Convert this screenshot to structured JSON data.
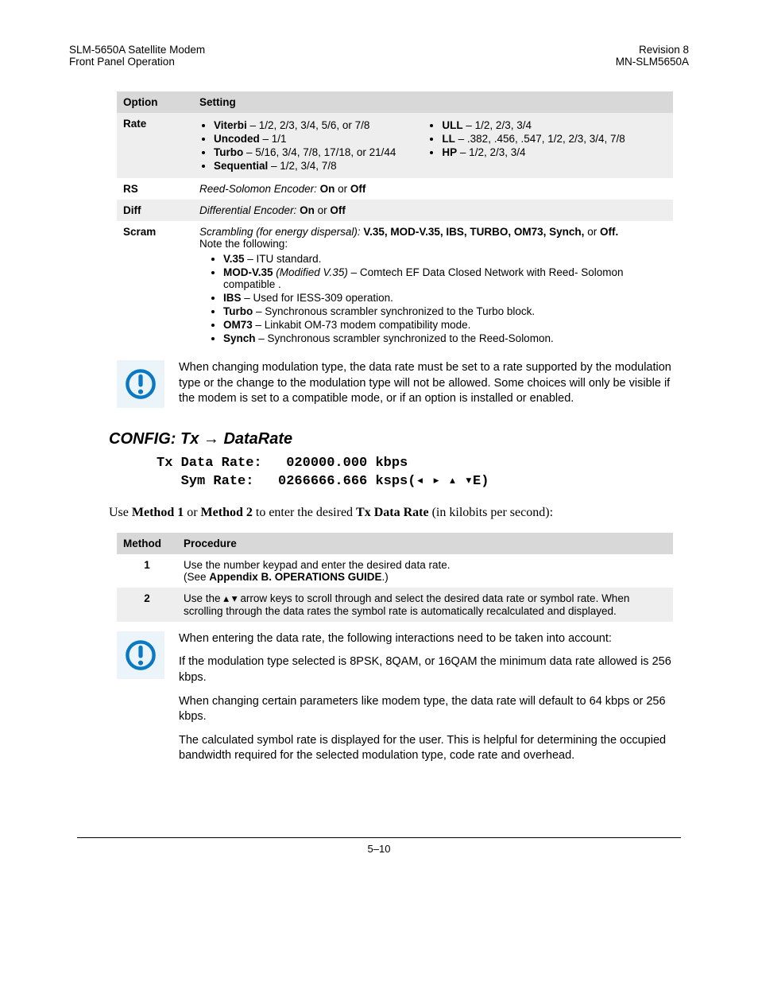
{
  "header": {
    "left": "SLM-5650A Satellite Modem\nFront Panel Operation",
    "right": "Revision 8\nMN-SLM5650A"
  },
  "table1": {
    "head_option": "Option",
    "head_setting": "Setting",
    "rate_label": "Rate",
    "rate_col1": {
      "viterbi_b": "Viterbi",
      "viterbi_t": " – 1/2, 2/3, 3/4, 5/6, or 7/8",
      "uncoded_b": "Uncoded",
      "uncoded_t": " – 1/1",
      "turbo_b": "Turbo",
      "turbo_t": " – 5/16, 3/4, 7/8, 17/18, or 21/44",
      "seq_b": "Sequential",
      "seq_t": " – 1/2, 3/4, 7/8"
    },
    "rate_col2": {
      "ull_b": "ULL",
      "ull_t": " – 1/2, 2/3, 3/4",
      "ll_b": "LL",
      "ll_t": " – .382, .456, .547, 1/2, 2/3, 3/4, 7/8",
      "hp_b": "HP",
      "hp_t": " – 1/2, 2/3, 3/4"
    },
    "rs_label": "RS",
    "rs_i": "Reed-Solomon Encoder: ",
    "rs_b1": "On",
    "rs_mid": " or ",
    "rs_b2": "Off",
    "diff_label": "Diff",
    "diff_i": "Differential Encoder: ",
    "diff_b1": "On",
    "diff_mid": " or ",
    "diff_b2": "Off",
    "scram_label": "Scram",
    "scram_i": "Scrambling (for energy dispersal): ",
    "scram_opts": "V.35, MOD-V.35, IBS, TURBO, OM73, Synch, ",
    "scram_or": "or ",
    "scram_off": "Off.",
    "scram_note": "Note the following:",
    "scram_items": {
      "v35_b": "V.35",
      "v35_t": " – ITU standard.",
      "mod_b": "MOD-V.35",
      "mod_i": " (Modified V.35)",
      "mod_t": " – Comtech EF Data Closed Network with Reed- Solomon compatible .",
      "ibs_b": "IBS",
      "ibs_t": " – Used for IESS-309 operation.",
      "turbo_b": "Turbo",
      "turbo_t": " – Synchronous scrambler synchronized to the Turbo block.",
      "om73_b": "OM73",
      "om73_t": " – Linkabit OM-73 modem compatibility mode.",
      "synch_b": "Synch",
      "synch_t": " – Synchronous scrambler synchronized to the Reed-Solomon."
    }
  },
  "note1": "When changing modulation type, the data rate must be set to a rate supported by the modulation type or the change to the modulation type will not be allowed. Some choices will only be visible if the modem is set to a compatible mode, or if an option is installed or enabled.",
  "section_heading_pre": "CONFIG: Tx ",
  "section_heading_post": " DataRate",
  "lcd_line1": "Tx Data Rate:   020000.000 kbps",
  "lcd_line2_a": "   Sym Rate:   0266666.666 ksps(",
  "lcd_line2_b": "E)",
  "body_p1_a": "Use ",
  "body_p1_b1": "Method 1",
  "body_p1_mid": " or ",
  "body_p1_b2": "Method 2",
  "body_p1_c": " to enter the desired ",
  "body_p1_b3": "Tx Data Rate",
  "body_p1_d": " (in kilobits per second):",
  "table2": {
    "head_method": "Method",
    "head_proc": "Procedure",
    "row1_num": "1",
    "row1_t1": "Use the number keypad and enter the desired data rate.",
    "row1_t2a": "(See ",
    "row1_t2b": "Appendix B. OPERATIONS GUIDE",
    "row1_t2c": ".)",
    "row2_num": "2",
    "row2_t_a": "Use the ",
    "row2_t_b": " arrow keys to scroll through and select the desired data rate or symbol rate. When scrolling through the data rates the symbol rate is automatically recalculated and displayed."
  },
  "note2_p1": "When entering the data rate, the following interactions need to be taken into account:",
  "note2_p2": "If the modulation type selected is 8PSK, 8QAM, or 16QAM the minimum data rate allowed is 256 kbps.",
  "note2_p3": "When changing certain parameters like modem type, the data rate will default to 64 kbps or 256 kbps.",
  "note2_p4": "The calculated symbol rate is displayed for the user. This is helpful for determining the occupied bandwidth required for the selected  modulation type, code rate and overhead.",
  "footer": "5–10"
}
